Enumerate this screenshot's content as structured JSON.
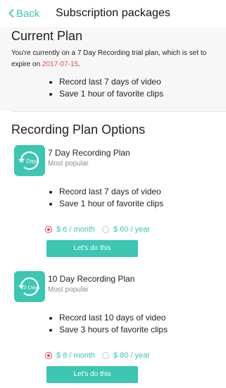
{
  "nav": {
    "back_label": "Back",
    "title": "Subscription packages"
  },
  "current_plan": {
    "heading": "Current Plan",
    "description_before": "You're currently on a 7 Day Recording trial plan, which is set to expire on ",
    "expiry_date": "2017-07-15",
    "description_after": ".",
    "bullets": [
      "Record last 7 days of video",
      "Save 1 hour of favorite clips"
    ]
  },
  "options": {
    "heading": "Recording Plan Options",
    "plans": [
      {
        "icon_label": "7 Days",
        "name": "7 Day Recording Plan",
        "subtitle": "Most popular",
        "bullets": [
          "Record last 7 days of video",
          "Save 1 hour of favorite clips"
        ],
        "monthly_price": "$ 6 / month",
        "yearly_price": "$ 60 / year",
        "selected": "monthly",
        "cta_label": "Let's do this"
      },
      {
        "icon_label": "10 Days",
        "name": "10 Day Recording Plan",
        "subtitle": "Most popular",
        "bullets": [
          "Record last 10 days of video",
          "Save 3 hours of favorite clips"
        ],
        "monthly_price": "$ 8 / month",
        "yearly_price": "$ 80 / year",
        "selected": "monthly",
        "cta_label": "Let's do this"
      }
    ]
  },
  "colors": {
    "accent": "#3cc6b3",
    "highlight": "#e34b4b",
    "section_bg": "#f7f7f7"
  }
}
